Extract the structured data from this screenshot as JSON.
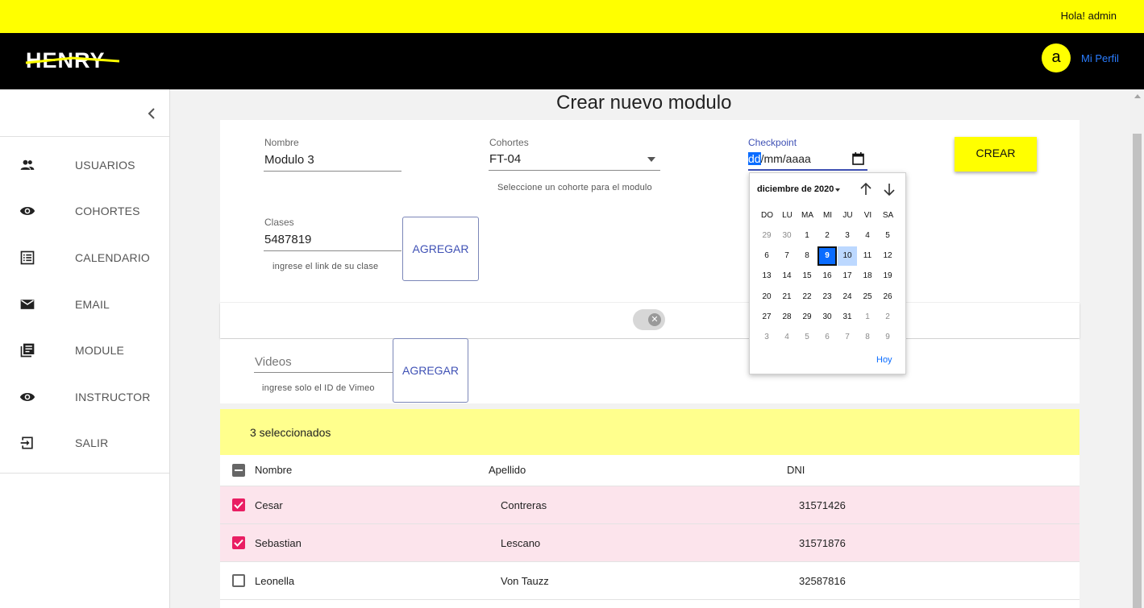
{
  "topbar": {
    "greeting": "Hola! admin",
    "color": "#ffff00"
  },
  "header": {
    "logo_text": "HENRY",
    "avatar_letter": "a",
    "profile_link": "Mi Perfil"
  },
  "sidebar": {
    "items": [
      {
        "label": "USUARIOS",
        "icon": "people-icon"
      },
      {
        "label": "COHORTES",
        "icon": "eye-icon"
      },
      {
        "label": "CALENDARIO",
        "icon": "list-icon"
      },
      {
        "label": "EMAIL",
        "icon": "mail-icon"
      },
      {
        "label": "MODULE",
        "icon": "library-books-icon"
      },
      {
        "label": "INSTRUCTOR",
        "icon": "eye-icon"
      },
      {
        "label": "SALIR",
        "icon": "exit-icon"
      }
    ]
  },
  "page": {
    "title": "Crear nuevo modulo"
  },
  "form": {
    "nombre": {
      "label": "Nombre",
      "value": "Modulo 3"
    },
    "cohortes": {
      "label": "Cohortes",
      "value": "FT-04",
      "helper": "Seleccione un cohorte para el modulo"
    },
    "checkpoint": {
      "label": "Checkpoint",
      "dd": "dd",
      "rest": "/mm/aaaa"
    },
    "crear_label": "CREAR",
    "clases": {
      "label": "Clases",
      "value": "5487819",
      "helper": "ingrese el link de su clase",
      "button": "AGREGAR"
    },
    "videos": {
      "placeholder": "Videos",
      "helper": "ingrese solo el ID de Vimeo",
      "button": "AGREGAR"
    }
  },
  "calendar": {
    "month_label": "diciembre de 2020",
    "weekdays": [
      "DO",
      "LU",
      "MA",
      "MI",
      "JU",
      "VI",
      "SA"
    ],
    "weeks": [
      [
        "29",
        "30",
        "1",
        "2",
        "3",
        "4",
        "5"
      ],
      [
        "6",
        "7",
        "8",
        "9",
        "10",
        "11",
        "12"
      ],
      [
        "13",
        "14",
        "15",
        "16",
        "17",
        "18",
        "19"
      ],
      [
        "20",
        "21",
        "22",
        "23",
        "24",
        "25",
        "26"
      ],
      [
        "27",
        "28",
        "29",
        "30",
        "31",
        "1",
        "2"
      ],
      [
        "3",
        "4",
        "5",
        "6",
        "7",
        "8",
        "9"
      ]
    ],
    "today_label": "Hoy",
    "selected_day": "9",
    "hover_day": "10"
  },
  "selection": {
    "text": "3 seleccionados"
  },
  "table": {
    "headers": {
      "nombre": "Nombre",
      "apellido": "Apellido",
      "dni": "DNI"
    },
    "rows": [
      {
        "nombre": "Cesar",
        "apellido": "Contreras",
        "dni": "31571426",
        "checked": true
      },
      {
        "nombre": "Sebastian",
        "apellido": "Lescano",
        "dni": "31571876",
        "checked": true
      },
      {
        "nombre": "Leonella",
        "apellido": "Von Tauzz",
        "dni": "32587816",
        "checked": false
      }
    ]
  },
  "colors": {
    "accent": "#ffff00",
    "checkbox": "#e91e63",
    "selected_row": "#fce4ec",
    "link": "#2a7dff"
  }
}
